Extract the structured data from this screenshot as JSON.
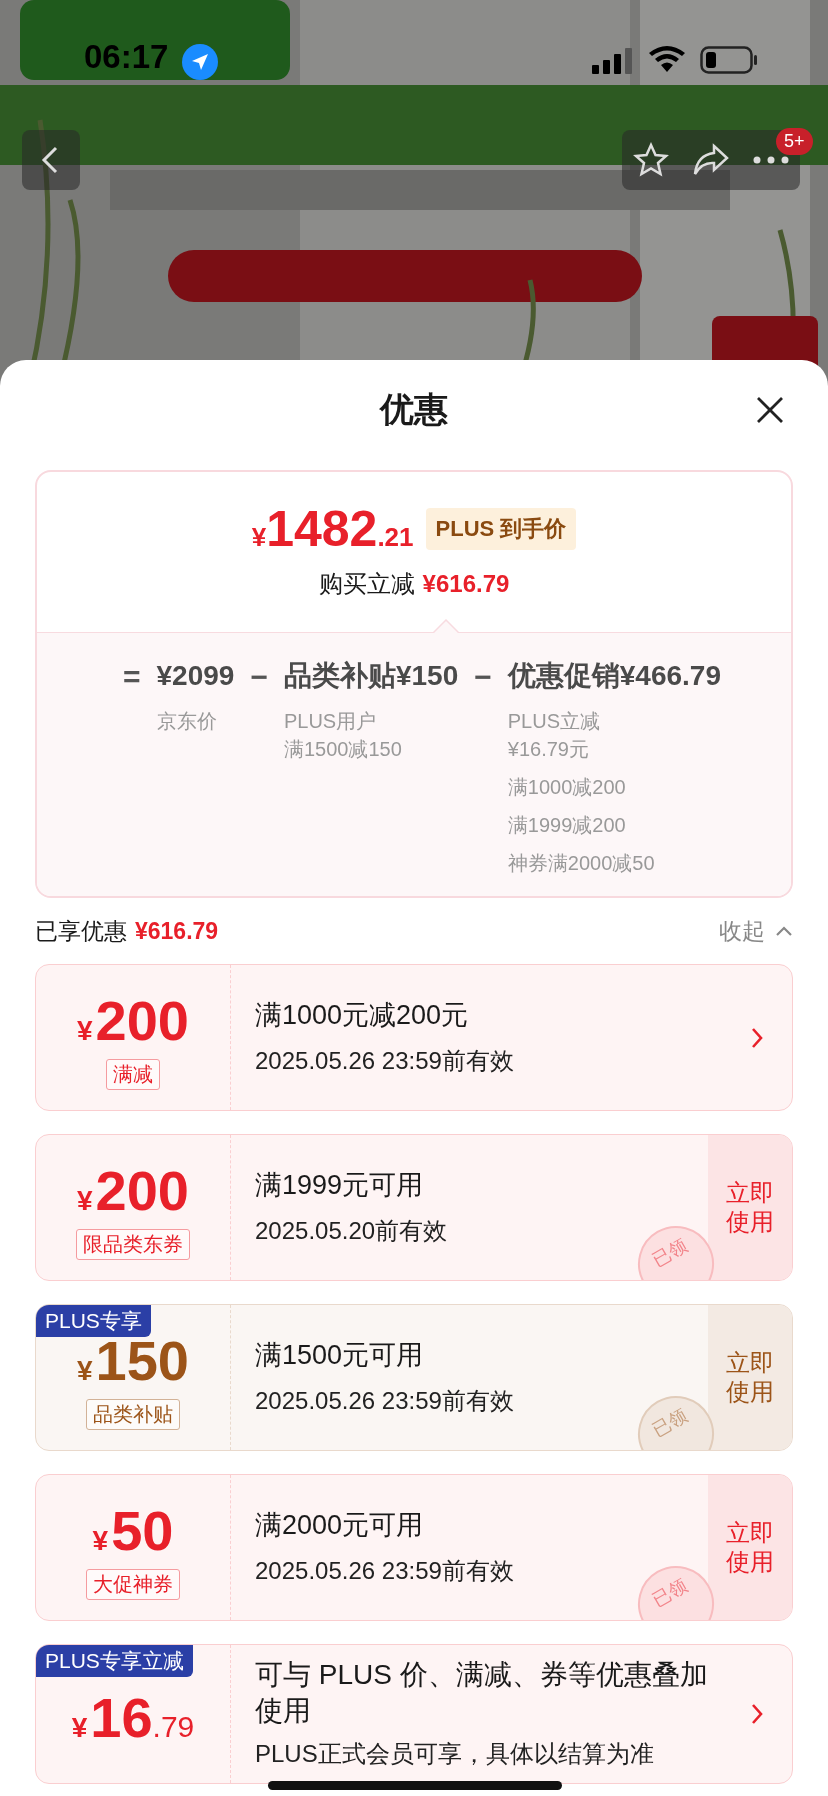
{
  "status_bar": {
    "time": "06:17"
  },
  "nav": {
    "badge": "5+"
  },
  "sheet": {
    "title": "优惠"
  },
  "price_card": {
    "currency": "¥",
    "integer": "1482",
    "decimal": ".21",
    "tag": "PLUS 到手价",
    "saving_label": "购买立减",
    "saving": "¥616.79",
    "terms": [
      {
        "operator": "=",
        "amount": "¥2099",
        "notes": [
          {
            "lines": [
              "京东价"
            ]
          }
        ]
      },
      {
        "operator": "−",
        "amount": "品类补贴¥150",
        "notes": [
          {
            "lines": [
              "PLUS用户",
              "满1500减150"
            ]
          }
        ]
      },
      {
        "operator": "−",
        "amount": "优惠促销¥466.79",
        "notes": [
          {
            "lines": [
              "PLUS立减",
              "¥16.79元"
            ]
          },
          {
            "lines": [
              "满1000减200"
            ]
          },
          {
            "lines": [
              "满1999减200"
            ]
          },
          {
            "lines": [
              "神券满2000减50"
            ]
          }
        ]
      }
    ]
  },
  "summary": {
    "label": "已享优惠",
    "amount": "¥616.79",
    "toggle": "收起",
    "expanded": true
  },
  "coupons": [
    {
      "kind": "arrow",
      "color": "#e8202a",
      "currency": "¥",
      "amount": "200",
      "label": "满减",
      "title": "满1000元减200元",
      "validity": "2025.05.26 23:59前有效"
    },
    {
      "kind": "use",
      "color": "#e8202a",
      "currency": "¥",
      "amount": "200",
      "label": "限品类东券",
      "title": "满1999元可用",
      "validity": "2025.05.20前有效",
      "action": "立即使用",
      "stamp": "已领"
    },
    {
      "kind": "use",
      "color": "#9c5418",
      "tag": "PLUS专享",
      "currency": "¥",
      "amount": "150",
      "label": "品类补贴",
      "title": "满1500元可用",
      "validity": "2025.05.26 23:59前有效",
      "action": "立即使用",
      "stamp": "已领"
    },
    {
      "kind": "use",
      "color": "#e8202a",
      "currency": "¥",
      "amount": "50",
      "label": "大促神券",
      "title": "满2000元可用",
      "validity": "2025.05.26 23:59前有效",
      "action": "立即使用",
      "stamp": "已领"
    },
    {
      "kind": "arrow",
      "color": "#e8202a",
      "tag": "PLUS专享立减",
      "currency": "¥",
      "amount": "16",
      "decimal": ".79",
      "title": "可与 PLUS 价、满减、券等优惠叠加使用",
      "validity": "PLUS正式会员可享，具体以结算为准"
    }
  ]
}
